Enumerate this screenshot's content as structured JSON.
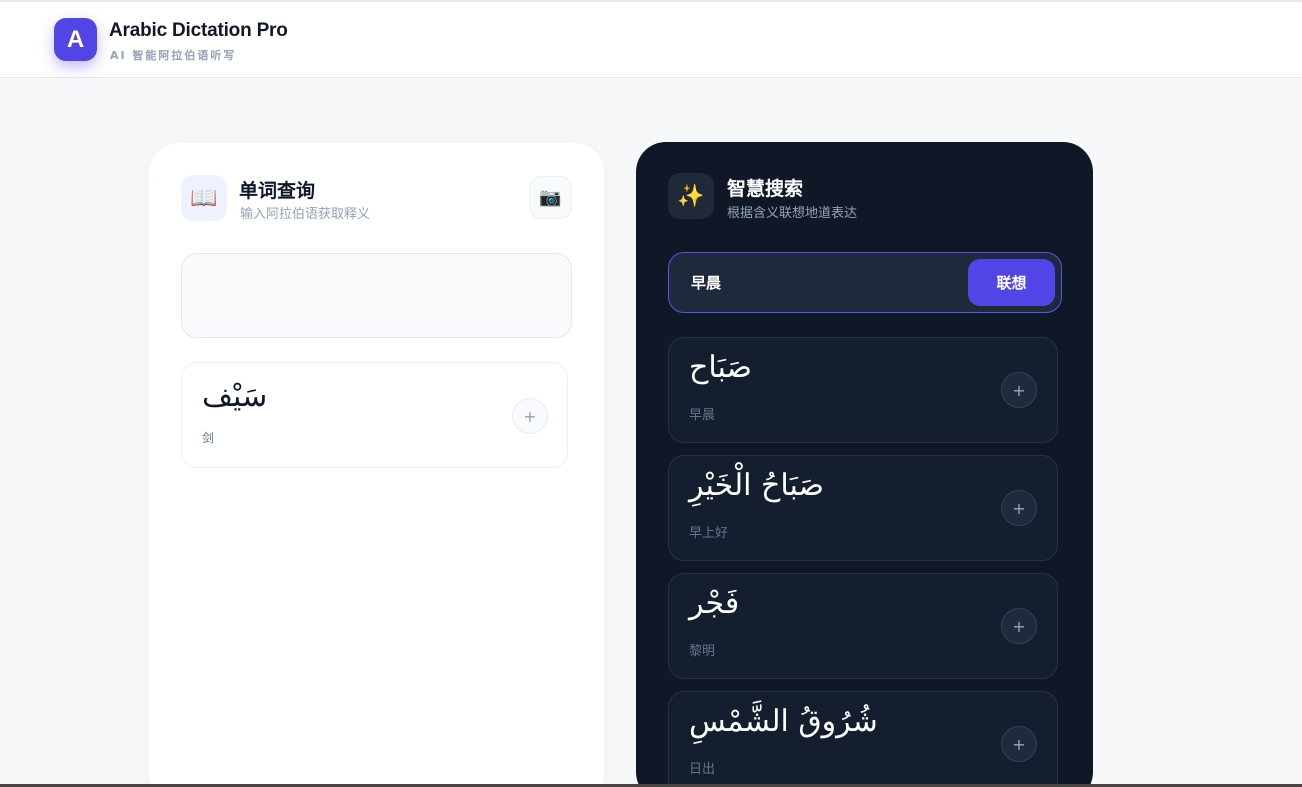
{
  "header": {
    "logo_letter": "A",
    "title": "Arabic Dictation Pro",
    "subtitle": "AI 智能阿拉伯语听写"
  },
  "lookup": {
    "icon": "book-icon",
    "title": "单词查询",
    "subtitle": "输入阿拉伯语获取释义",
    "camera_icon": "camera-icon",
    "input_value": "",
    "input_placeholder": "",
    "results": [
      {
        "arabic": "سَيْف",
        "meaning": "剑"
      }
    ]
  },
  "smart_search": {
    "icon": "sparkles-icon",
    "title": "智慧搜索",
    "subtitle": "根据含义联想地道表达",
    "query": "早晨",
    "button_label": "联想",
    "suggestions": [
      {
        "arabic": "صَبَاح",
        "meaning": "早晨"
      },
      {
        "arabic": "صَبَاحُ الْخَيْرِ",
        "meaning": "早上好"
      },
      {
        "arabic": "فَجْر",
        "meaning": "黎明"
      },
      {
        "arabic": "شُرُوقُ الشَّمْسِ",
        "meaning": "日出"
      }
    ]
  },
  "colors": {
    "accent": "#5145e5",
    "dark_panel": "#101827",
    "page_bg": "#f7f8fa"
  }
}
